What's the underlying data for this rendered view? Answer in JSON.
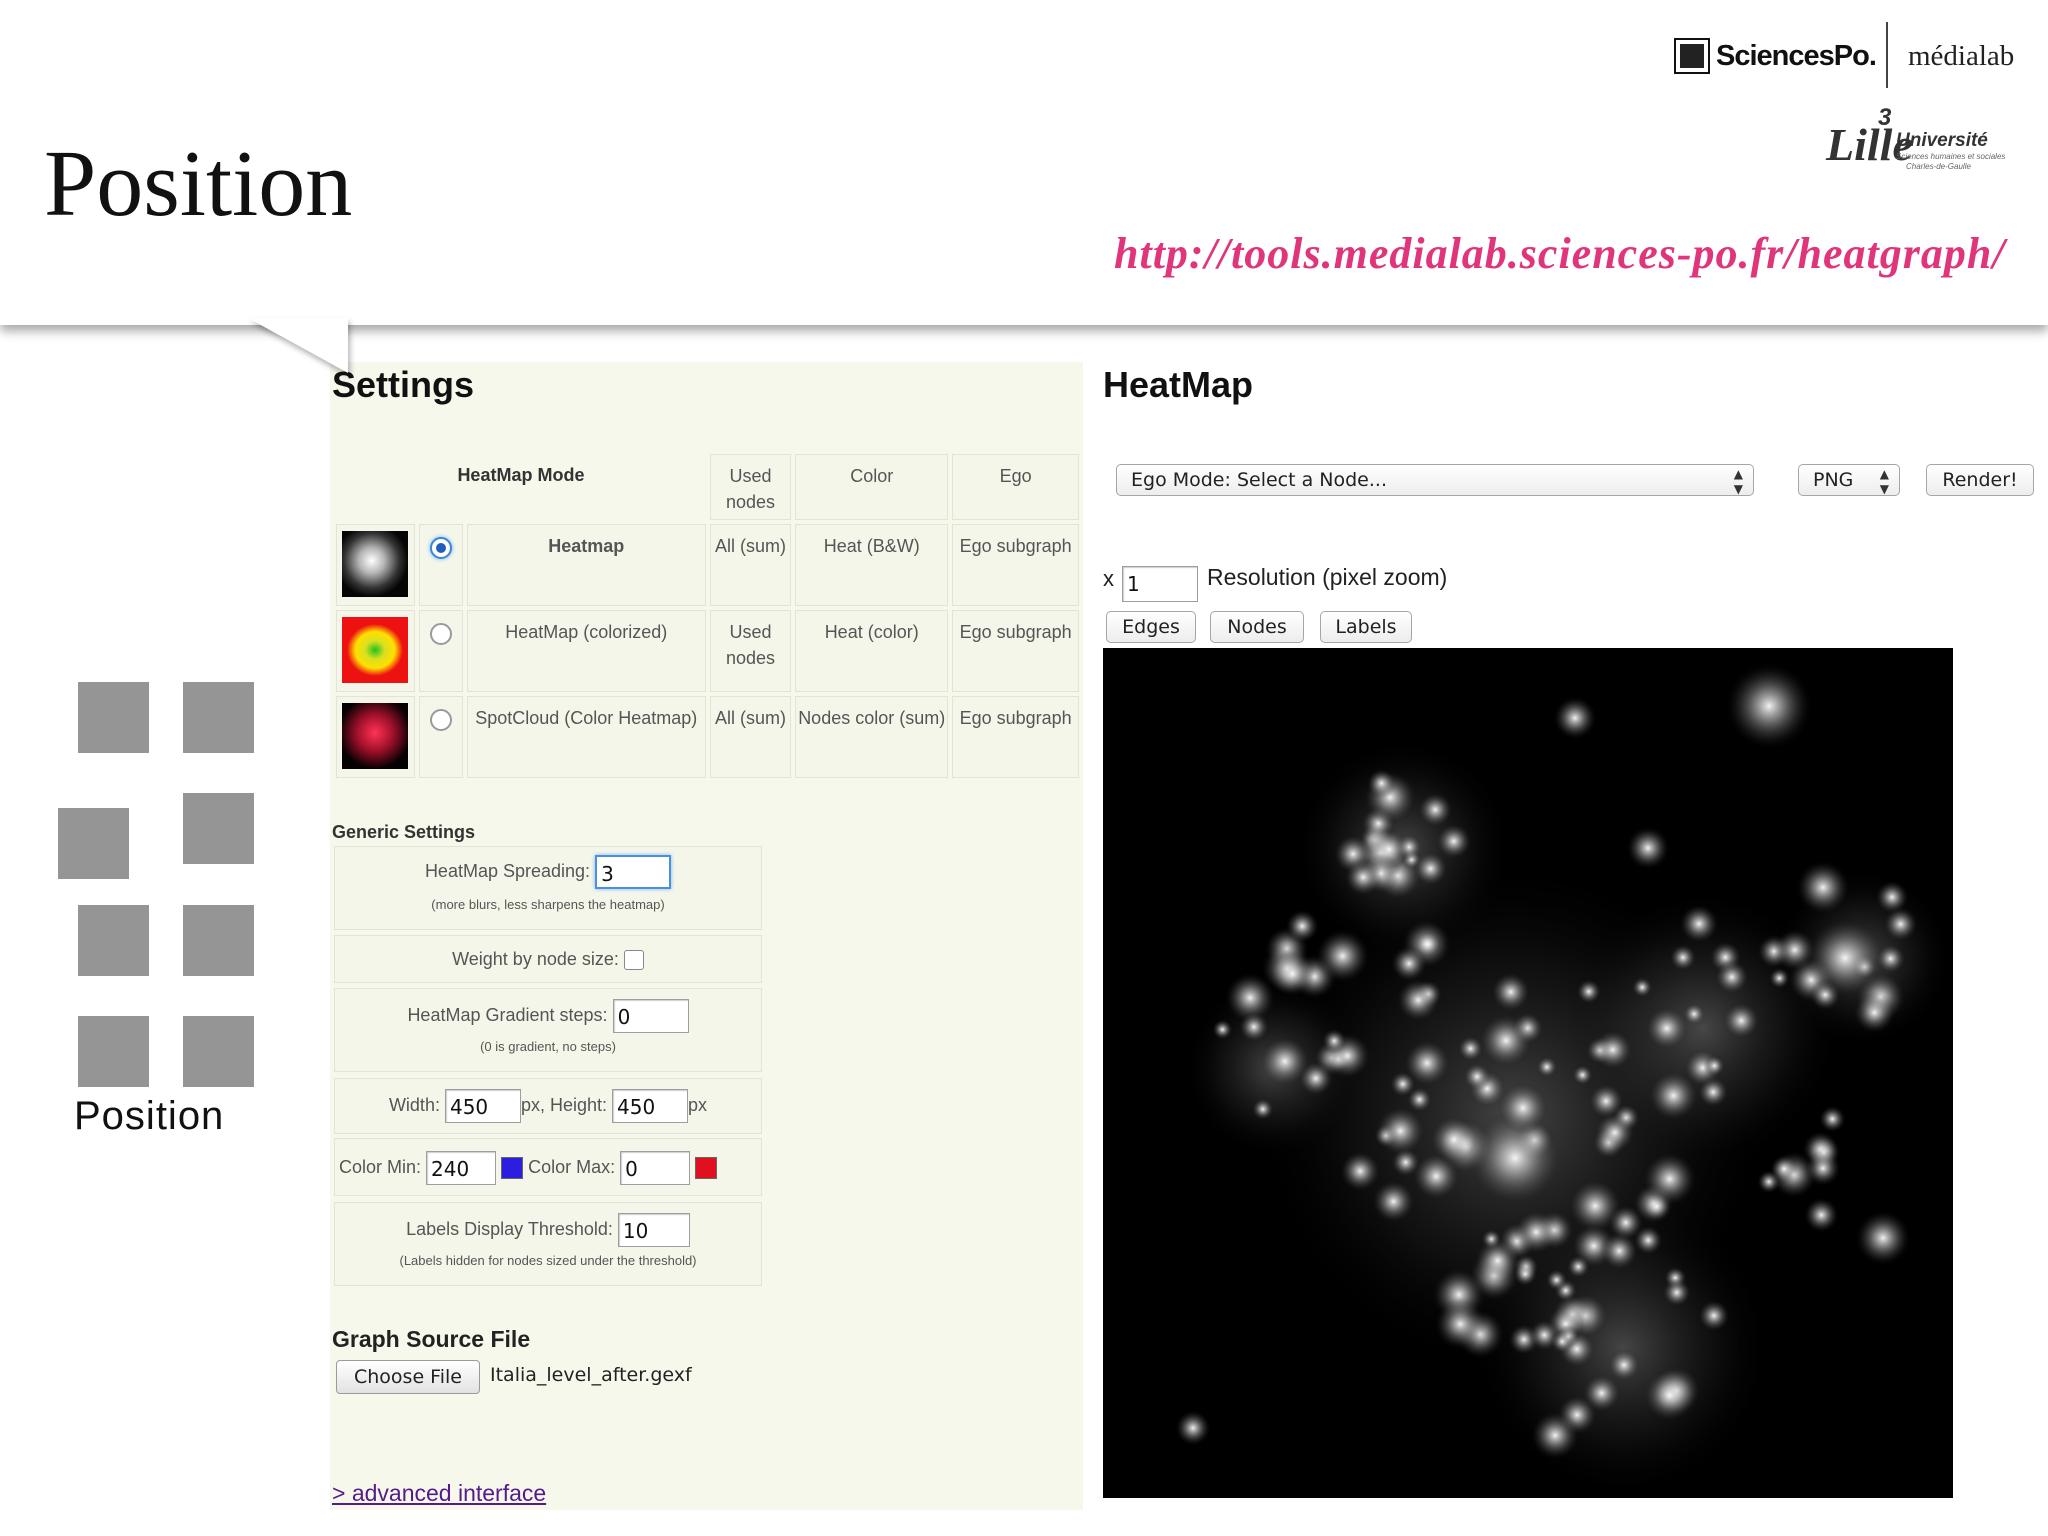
{
  "slide": {
    "title": "Position",
    "url": "http://tools.medialab.sciences-po.fr/heatgraph/",
    "logos": {
      "sciencespo": "SciencesPo.",
      "medialab": "médialab",
      "lille_word": "Lille",
      "lille_number": "3",
      "lille_universite": "Université",
      "lille_sub1": "Sciences humaines et sociales",
      "lille_sub2": "Charles-de-Gaulle"
    },
    "side_icon_label": "Position"
  },
  "settings": {
    "title": "Settings",
    "table": {
      "mode_header": "HeatMap Mode",
      "col_used": "Used nodes",
      "col_color": "Color",
      "col_ego": "Ego",
      "rows": [
        {
          "name": "Heatmap",
          "used": "All (sum)",
          "color": "Heat (B&W)",
          "ego": "Ego subgraph",
          "selected": true
        },
        {
          "name": "HeatMap (colorized)",
          "used": "Used nodes",
          "color": "Heat (color)",
          "ego": "Ego subgraph",
          "selected": false
        },
        {
          "name": "SpotCloud (Color Heatmap)",
          "used": "All (sum)",
          "color": "Nodes color (sum)",
          "ego": "Ego subgraph",
          "selected": false
        }
      ]
    },
    "generic": {
      "title": "Generic Settings",
      "spreading_label": "HeatMap Spreading:",
      "spreading_value": "3",
      "spreading_hint": "(more blurs, less sharpens the heatmap)",
      "weight_label": "Weight by node size:",
      "gradient_label": "HeatMap Gradient steps:",
      "gradient_value": "0",
      "gradient_hint": "(0 is gradient, no steps)",
      "width_label": "Width:",
      "width_value": "450",
      "height_label": "px, Height:",
      "height_value": "450",
      "px_label": "px",
      "color_min_label": "Color Min:",
      "color_min_value": "240",
      "color_min_swatch": "#2a1fe0",
      "color_max_label": "Color Max:",
      "color_max_value": "0",
      "color_max_swatch": "#e01020",
      "labels_label": "Labels Display Threshold:",
      "labels_value": "10",
      "labels_hint": "(Labels hidden for nodes sized under the threshold)"
    },
    "source": {
      "title": "Graph Source File",
      "choose_label": "Choose File",
      "file_name": "Italia_level_after.gexf"
    },
    "advanced_link": "> advanced interface"
  },
  "heatmap": {
    "title": "HeatMap",
    "ego_select": "Ego Mode: Select a Node...",
    "format_select": "PNG",
    "render_label": "Render!",
    "x_label": "x",
    "resolution_value": "1",
    "resolution_label": "Resolution (pixel zoom)",
    "edges_label": "Edges",
    "nodes_label": "Nodes",
    "labels_label": "Labels"
  }
}
